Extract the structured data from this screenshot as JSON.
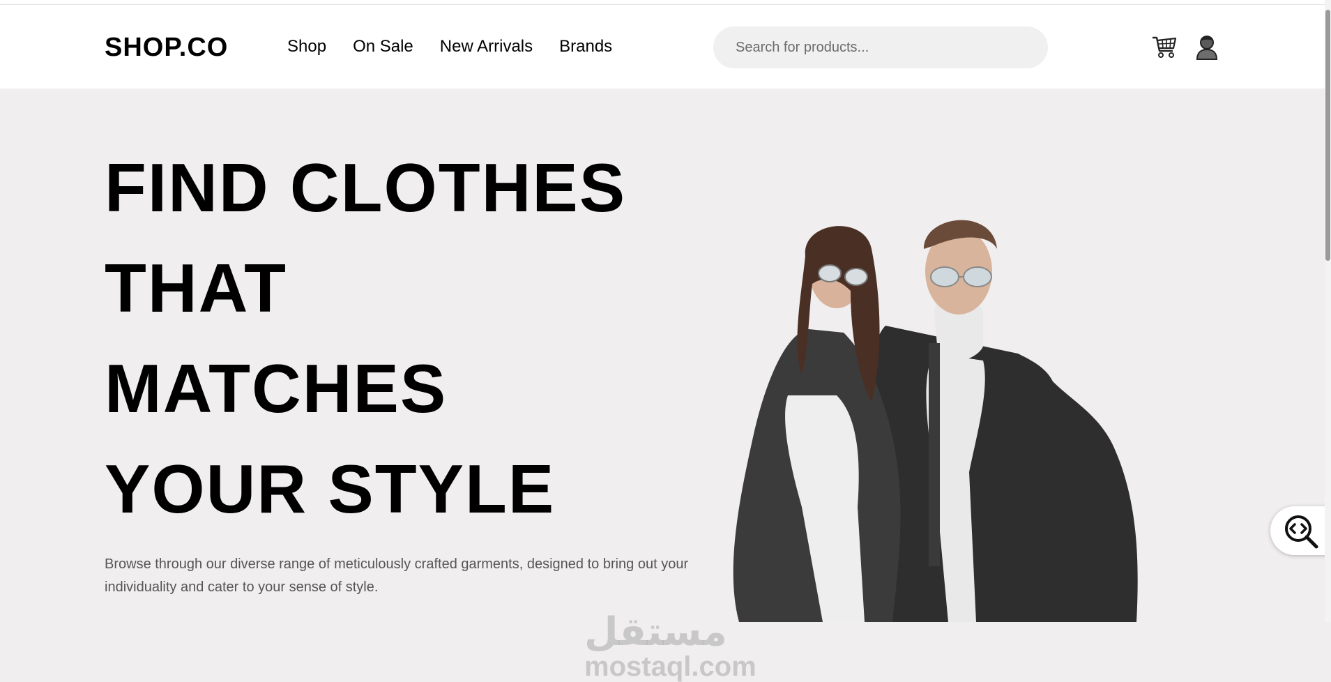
{
  "header": {
    "logo": "SHOP.CO",
    "nav": [
      {
        "label": "Shop"
      },
      {
        "label": "On Sale"
      },
      {
        "label": "New Arrivals"
      },
      {
        "label": "Brands"
      }
    ],
    "search": {
      "placeholder": "Search for products...",
      "value": ""
    },
    "icons": [
      "cart-icon",
      "user-icon"
    ]
  },
  "hero": {
    "headline": [
      "FIND CLOTHES",
      "THAT",
      "MATCHES",
      "YOUR STYLE"
    ],
    "description": "Browse through our diverse range of meticulously crafted garments, designed to bring out your individuality and cater to your sense of style."
  },
  "watermark": {
    "arabic": "مستقل",
    "text": "mostaql.com"
  },
  "floating_button": {
    "icon": "code-search-icon"
  },
  "colors": {
    "background": "#f0eeef",
    "header": "#ffffff",
    "text": "#000000",
    "muted": "#555555"
  }
}
